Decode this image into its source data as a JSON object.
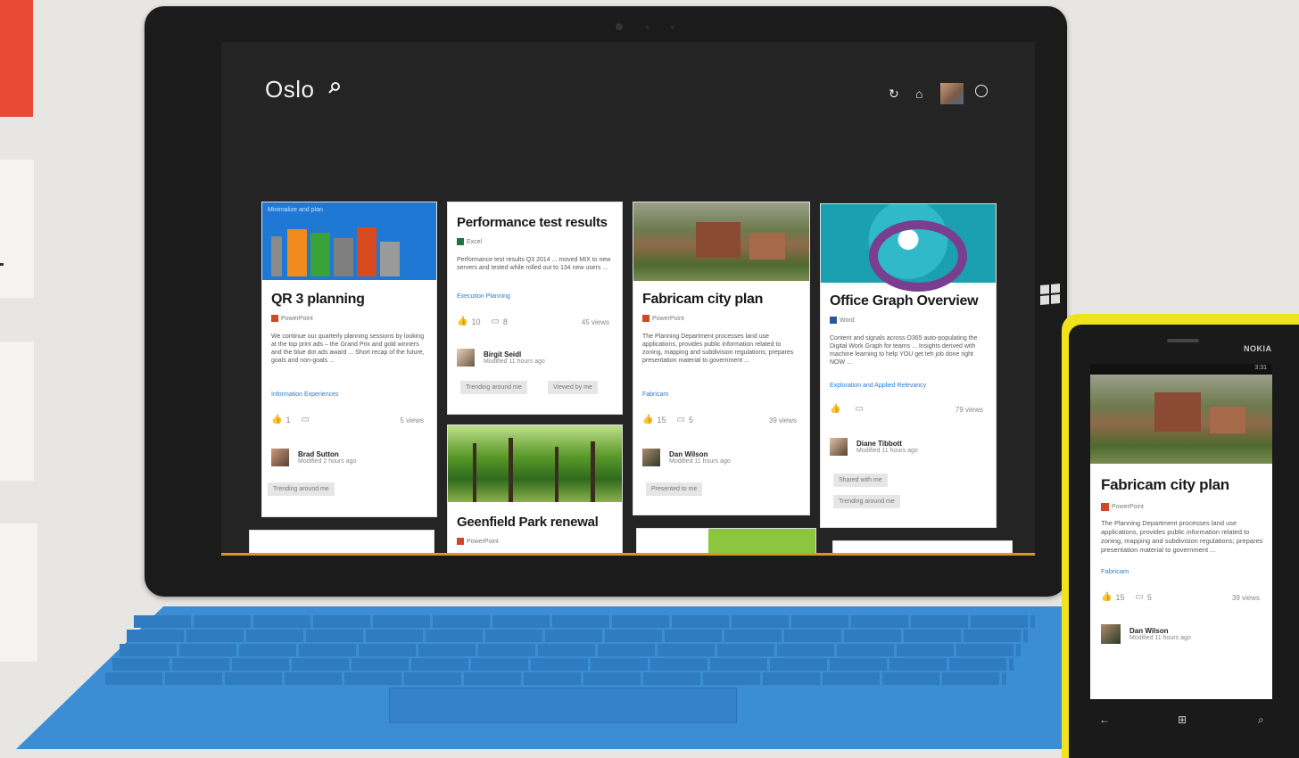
{
  "app": {
    "title": "Oslo"
  },
  "colors": {
    "accent_red": "#e84a36",
    "keyboard_blue": "#3c8ed4",
    "phone_yellow": "#f1e21e",
    "link_blue": "#2a7bd6"
  },
  "icons": {
    "title_search": "search-icon",
    "refresh": "refresh-icon",
    "home": "home-icon",
    "profile": "avatar",
    "feedback": "smiley-icon"
  },
  "cards": [
    {
      "title": "QR 3 planning",
      "thumb_title": "Minimalize and plan",
      "app": "PowerPoint",
      "desc": "We continue our quarterly planning sessions by looking at the top print ads – the Grand Prix and gold winners and the blue dot ads award ... Short recap of the future, goals and non-goals ...",
      "tag": "Information Experiences",
      "likes": "1",
      "comments": "",
      "views": "5 views",
      "person": "Brad Sutton",
      "modified": "Modified 2 hours ago",
      "chips": [
        "Trending around me"
      ]
    },
    {
      "title": "Performance test results",
      "app": "Excel",
      "desc": "Performance test results Q3 2014 ... moved MIX to new servers and tested while rolled out to 134 new users ...",
      "tag": "Execution Planning",
      "likes": "10",
      "comments": "8",
      "views": "45 views",
      "person": "Birgit Seidl",
      "modified": "Modified 11 hours ago",
      "chips": [
        "Trending around me",
        "Viewed by me"
      ]
    },
    {
      "title": "Geenfield Park renewal",
      "app": "PowerPoint"
    },
    {
      "title": "Fabricam city plan",
      "app": "PowerPoint",
      "desc": "The Planning Department processes land use applications, provides public information related to zoning, mapping and subdivision regulations; prepares presentation material to government ...",
      "tag": "Fabricam",
      "likes": "15",
      "comments": "5",
      "views": "39 views",
      "person": "Dan Wilson",
      "modified": "Modified 11 hours ago",
      "chips": [
        "Presented to me"
      ]
    },
    {
      "title": "Office Graph Overview",
      "app": "Word",
      "desc": "Content and signals across O365 auto-populating the Digital Work Graph for teams ... Insights derived with machine learning to help YOU get teh job done right NOW ...",
      "tag": "Exploration and Applied Relevancy",
      "likes": "",
      "comments": "",
      "views": "79 views",
      "person": "Diane Tibbott",
      "modified": "Modified 11 hours ago",
      "chips": [
        "Shared with me",
        "Trending around me"
      ]
    }
  ],
  "phone": {
    "brand": "NOKIA",
    "time": "3:31",
    "card": {
      "title": "Fabricam city plan",
      "app": "PowerPoint",
      "desc": "The Planning Department processes land use applications, provides public information related to zoning, mapping and subdivision regulations; prepares presentation material to government ...",
      "tag": "Fabricam",
      "likes": "15",
      "comments": "5",
      "views": "39 views",
      "person": "Dan Wilson",
      "modified": "Modified 11 hours ago"
    }
  }
}
